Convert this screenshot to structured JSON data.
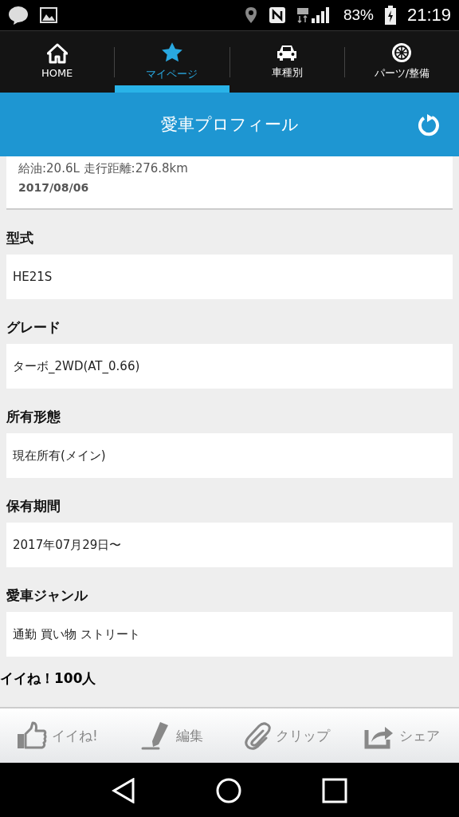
{
  "status_bar": {
    "battery": "83%",
    "time": "21:19"
  },
  "tabs": [
    {
      "label": "HOME",
      "kind": "home",
      "selected": false
    },
    {
      "label": "マイページ",
      "kind": "star",
      "selected": true
    },
    {
      "label": "車種別",
      "kind": "car",
      "selected": false
    },
    {
      "label": "パーツ/整備",
      "kind": "wheel",
      "selected": false
    }
  ],
  "header": {
    "title": "愛車プロフィール"
  },
  "fuel_card": {
    "detail": "給油:20.6L 走行距離:276.8km",
    "date": "2017/08/06"
  },
  "fields": [
    {
      "label": "型式",
      "value": "HE21S"
    },
    {
      "label": "グレード",
      "value": "ターボ_2WD(AT_0.66)"
    },
    {
      "label": "所有形態",
      "value": "現在所有(メイン)"
    },
    {
      "label": "保有期間",
      "value": "2017年07月29日〜"
    },
    {
      "label": "愛車ジャンル",
      "value": "通勤 買い物 ストリート"
    }
  ],
  "likes": "イイね！100人",
  "actions": [
    {
      "label": "イイね!",
      "kind": "thumb"
    },
    {
      "label": "編集",
      "kind": "pen"
    },
    {
      "label": "クリップ",
      "kind": "clip"
    },
    {
      "label": "シェア",
      "kind": "share"
    }
  ]
}
